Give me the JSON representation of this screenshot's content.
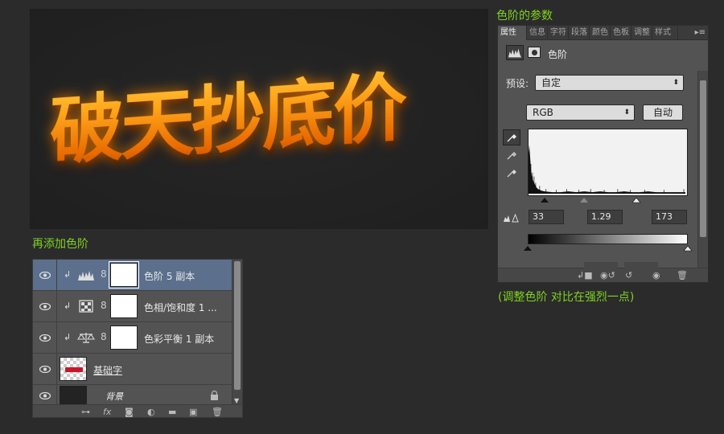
{
  "canvas": {
    "artwork_text": "破天抄底价"
  },
  "labels": {
    "top_right": "色阶的参数",
    "left_mid": "再添加色阶",
    "bottom_right": "(调整色阶 对比在强烈一点)"
  },
  "layers_panel": {
    "layers": [
      {
        "name": "色阶 5 副本",
        "type": "levels-adjustment",
        "selected": true
      },
      {
        "name": "色相/饱和度 1 ...",
        "type": "hue-saturation-adjustment",
        "selected": false
      },
      {
        "name": "色彩平衡 1 副本",
        "type": "color-balance-adjustment",
        "selected": false
      },
      {
        "name": "基础字",
        "type": "text-raster",
        "selected": false
      },
      {
        "name": "背景",
        "type": "background",
        "selected": false
      }
    ],
    "footer_icons": [
      "link-icon",
      "fx-icon",
      "mask-icon",
      "adjustment-icon",
      "folder-icon",
      "new-layer-icon",
      "trash-icon"
    ],
    "footer_fx": "fx"
  },
  "properties_panel": {
    "tabs": [
      "属性",
      "信息",
      "字符",
      "段落",
      "颜色",
      "色板",
      "调整",
      "样式"
    ],
    "active_tab": "属性",
    "title": "色阶",
    "preset_label": "预设:",
    "preset_value": "自定",
    "channel_value": "RGB",
    "auto_button": "自动",
    "input_black": "33",
    "input_gamma": "1.29",
    "input_white": "173"
  },
  "colors": {
    "accent_green": "#7ed321",
    "panel_bg": "#535353",
    "selected_row": "#5c6f8c",
    "text_orange": "#ff9a10"
  }
}
